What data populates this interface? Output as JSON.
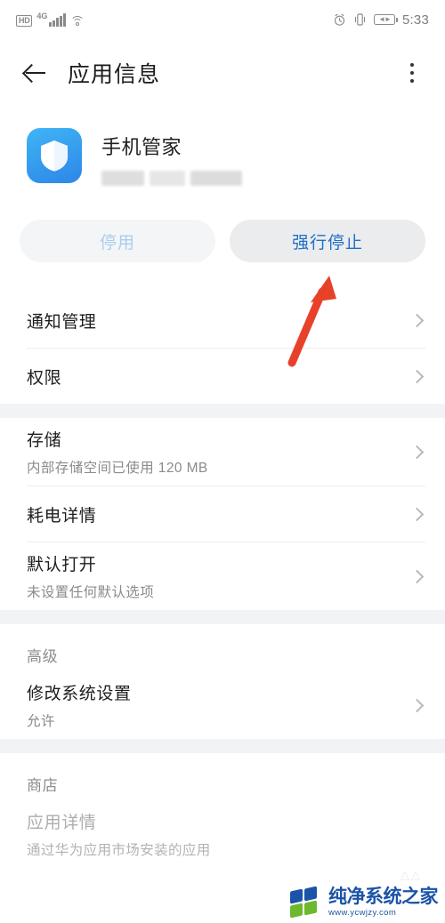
{
  "statusbar": {
    "hd_label": "HD",
    "network_label": "4G",
    "signal_icon": "signal-bars-icon",
    "wifi_icon": "wifi-icon",
    "alarm_icon": "alarm-clock-icon",
    "vibrate_icon": "vibrate-mode-icon",
    "battery_icon": "battery-icon",
    "time": "5:33"
  },
  "toolbar": {
    "back_icon": "back-arrow-icon",
    "title": "应用信息",
    "overflow_icon": "overflow-menu-icon"
  },
  "app": {
    "icon": "shield-app-icon",
    "name": "手机管家",
    "version_redacted": true
  },
  "actions": {
    "disable_label": "停用",
    "force_stop_label": "强行停止"
  },
  "sections": [
    {
      "label": null,
      "rows": [
        {
          "title": "通知管理",
          "sub": null,
          "name": "row-notification-management"
        },
        {
          "title": "权限",
          "sub": null,
          "name": "row-permissions"
        }
      ]
    },
    {
      "label": null,
      "rows": [
        {
          "title": "存储",
          "sub": "内部存储空间已使用 120 MB",
          "name": "row-storage"
        },
        {
          "title": "耗电详情",
          "sub": null,
          "name": "row-battery-usage"
        },
        {
          "title": "默认打开",
          "sub": "未设置任何默认选项",
          "name": "row-open-by-default"
        }
      ]
    },
    {
      "label": "高级",
      "rows": [
        {
          "title": "修改系统设置",
          "sub": "允许",
          "name": "row-modify-system-settings"
        }
      ]
    },
    {
      "label": "商店",
      "rows": [
        {
          "title": "应用详情",
          "sub": "通过华为应用市场安装的应用",
          "name": "row-app-details",
          "muted": true
        }
      ]
    }
  ],
  "annotation": {
    "arrow_icon": "red-arrow-annotation",
    "color": "#e8412a",
    "points_to": "force-stop-button"
  },
  "watermark": {
    "logo_icon": "four-squares-logo-icon",
    "title": "纯净系统之家",
    "url": "www.ycwjzy.com",
    "colors": {
      "blue": "#1a53a8",
      "green": "#6cb82e"
    }
  },
  "theme": {
    "accent_blue": "#1e70c8",
    "disabled_blue": "#a9cdf0",
    "page_bg": "#ffffff",
    "gap_bg": "#f2f3f5"
  }
}
